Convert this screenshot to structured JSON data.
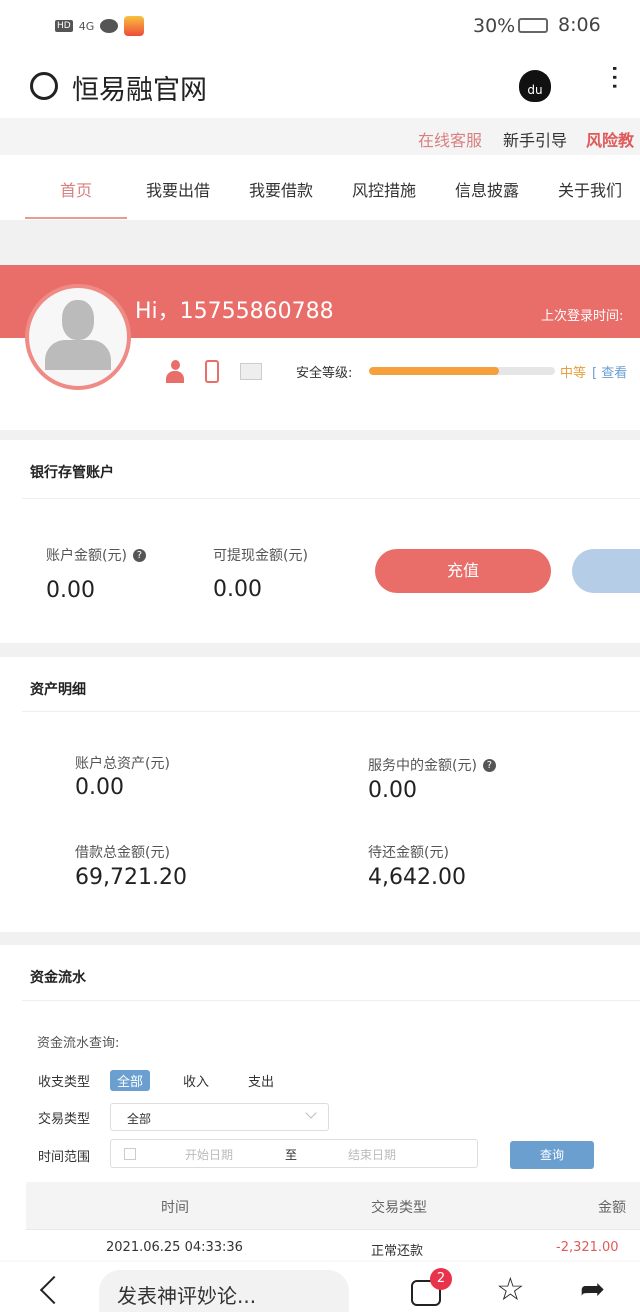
{
  "status_bar": {
    "battery": "30%",
    "time": "8:06",
    "network": "4G"
  },
  "browser": {
    "title": "恒易融官网",
    "comment_placeholder": "发表神评妙论...",
    "comment_count": "2"
  },
  "top_links": [
    {
      "label": "在线客服"
    },
    {
      "label": "新手引导"
    },
    {
      "label": "风险教"
    }
  ],
  "nav": [
    {
      "label": "首页",
      "active": true
    },
    {
      "label": "我要出借"
    },
    {
      "label": "我要借款"
    },
    {
      "label": "风控措施"
    },
    {
      "label": "信息披露"
    },
    {
      "label": "关于我们"
    }
  ],
  "profile": {
    "greeting": "Hi，15755860788",
    "last_login_label": "上次登录时间:",
    "security_label": "安全等级:",
    "security_level": "中等",
    "security_progress": 0.7,
    "view_link": "[ 查看"
  },
  "bank": {
    "title": "银行存管账户",
    "balance_label": "账户金额(元)",
    "balance": "0.00",
    "withdrawable_label": "可提现金额(元)",
    "withdrawable": "0.00",
    "recharge_label": "充值"
  },
  "assets": {
    "title": "资产明细",
    "items": [
      {
        "label": "账户总资产(元)",
        "value": "0.00"
      },
      {
        "label": "服务中的金额(元)",
        "value": "0.00"
      },
      {
        "label": "借款总金额(元)",
        "value": "69,721.20"
      },
      {
        "label": "待还金额(元)",
        "value": "4,642.00"
      }
    ]
  },
  "flow": {
    "title": "资金流水",
    "query_label": "资金流水查询:",
    "type_label": "收支类型",
    "type_options": [
      "全部",
      "收入",
      "支出"
    ],
    "trade_label": "交易类型",
    "trade_value": "全部",
    "range_label": "时间范围",
    "start_placeholder": "开始日期",
    "to": "至",
    "end_placeholder": "结束日期",
    "query_button": "查询",
    "columns": [
      "时间",
      "交易类型",
      "金额"
    ],
    "rows": [
      {
        "time": "2021.06.25 04:33:36",
        "type": "正常还款",
        "amount": "-2,321.00"
      }
    ]
  }
}
